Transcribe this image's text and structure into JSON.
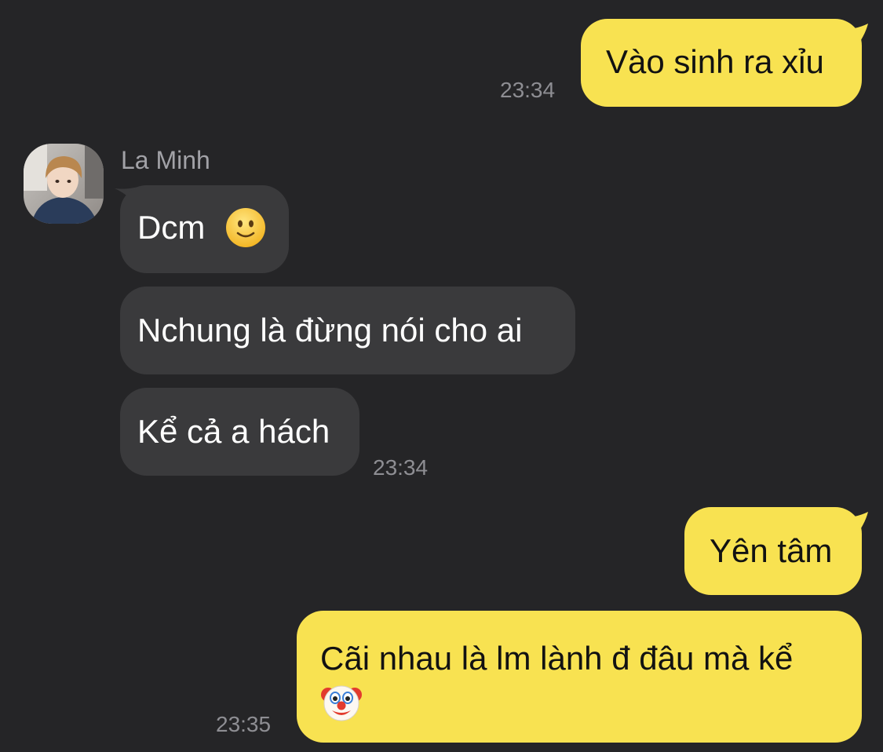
{
  "colors": {
    "background": "#252527",
    "outgoing_bubble": "#f8e251",
    "incoming_bubble": "#3a3a3c",
    "timestamp": "#8e8e93"
  },
  "messages": [
    {
      "direction": "outgoing",
      "text": "Vào sinh ra xỉu",
      "time": "23:34"
    },
    {
      "direction": "incoming",
      "sender": "La Minh",
      "avatar": "user-avatar-photo",
      "items": [
        {
          "text": "Dcm",
          "emoji": "slightly-smiling-face-icon"
        },
        {
          "text": "Nchung là đừng nói cho ai"
        },
        {
          "text": "Kể cả a hách",
          "time": "23:34"
        }
      ]
    },
    {
      "direction": "outgoing",
      "text": "Yên tâm"
    },
    {
      "direction": "outgoing",
      "text": "Cãi nhau là lm lành đ đâu mà kể",
      "emoji": "clown-face-icon",
      "time": "23:35"
    }
  ]
}
